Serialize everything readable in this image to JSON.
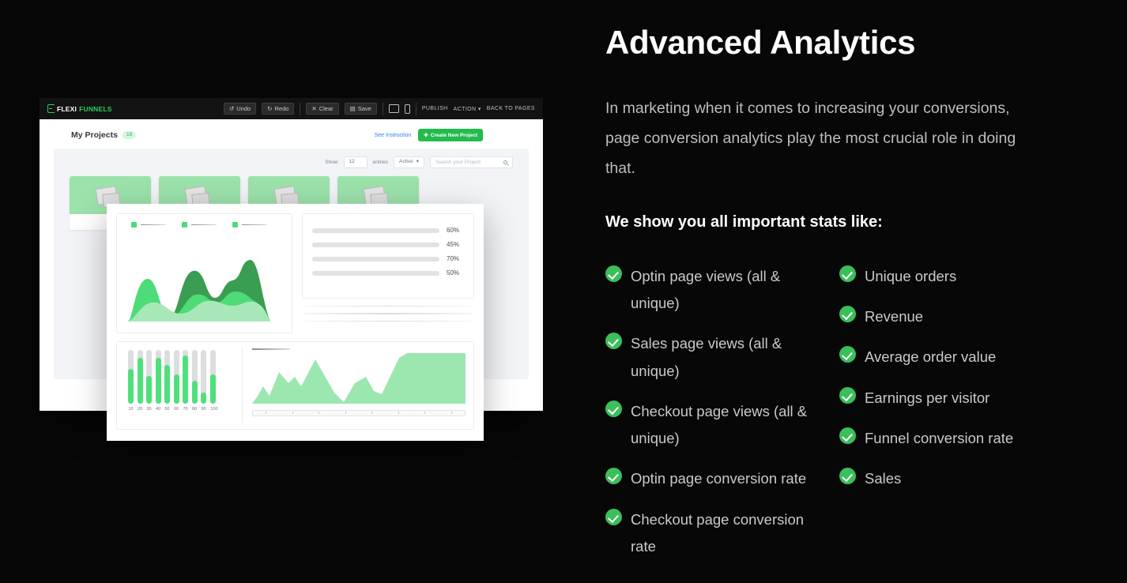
{
  "app": {
    "logo": {
      "first": "FLEXI",
      "second": "FUNNELS",
      "icon": "flexifunnels-logo-icon"
    },
    "toolbar": {
      "undo": "Undo",
      "redo": "Redo",
      "clear": "Clear",
      "save": "Save",
      "desktop_icon": "desktop-view-icon",
      "mobile_icon": "mobile-view-icon",
      "publish": "PUBLISH",
      "action": "ACTION",
      "back_to_pages": "BACK TO PAGES"
    },
    "projects": {
      "title": "My Projects",
      "count": "19",
      "see_instruction": "See Instruction",
      "create_button": "Create New Project",
      "create_button_icon": "plus-icon",
      "controls": {
        "show_label": "Show",
        "entries_value": "12",
        "entries_label": "entries",
        "status_value": "Active",
        "search_placeholder": "Search your Project",
        "search_icon": "search-icon"
      },
      "cards": [
        "project-card-1",
        "project-card-2",
        "project-card-3",
        "project-card-4"
      ]
    }
  },
  "analytics_card": {
    "legend": [
      {
        "color": "#4ddc77"
      },
      {
        "color": "#4ddc77"
      },
      {
        "color": "#4ddc77"
      }
    ],
    "progress_bars": [
      {
        "label": "60%",
        "value": 60,
        "color": "#4fe07c"
      },
      {
        "label": "45%",
        "value": 45,
        "color": "#5a3338"
      },
      {
        "label": "70%",
        "value": 70,
        "color": "#5a3338"
      },
      {
        "label": "50%",
        "value": 50,
        "color": "#5a3338"
      }
    ]
  },
  "chart_data": [
    {
      "type": "area",
      "title": "",
      "xlabel": "",
      "ylabel": "",
      "grid": false,
      "legend": "top-left",
      "series": [
        {
          "name": "series-dark",
          "color": "#3a9e52",
          "values": [
            8,
            14,
            30,
            22,
            58,
            48,
            40,
            52,
            46,
            66,
            60,
            20
          ]
        },
        {
          "name": "series-medium",
          "color": "#4ddc77",
          "values": [
            6,
            42,
            34,
            14,
            26,
            22,
            18,
            32,
            26,
            30,
            36,
            12
          ]
        },
        {
          "name": "series-light",
          "color": "#a8e8b8",
          "values": [
            4,
            20,
            22,
            18,
            24,
            20,
            22,
            26,
            22,
            24,
            26,
            8
          ]
        }
      ]
    },
    {
      "type": "bar",
      "title": "",
      "xlabel": "",
      "ylabel": "",
      "ylim": [
        0,
        100
      ],
      "categories": [
        "10",
        "20",
        "30",
        "40",
        "50",
        "60",
        "70",
        "80",
        "90",
        "100"
      ],
      "values": [
        65,
        85,
        52,
        85,
        72,
        55,
        90,
        42,
        20,
        55
      ],
      "color": "#4fe07c",
      "track_color": "#dddddd"
    },
    {
      "type": "area",
      "title": "",
      "xlabel": "",
      "ylabel": "",
      "grid": false,
      "color": "#9ce7b0",
      "x": [
        0,
        1,
        2,
        3,
        4,
        5,
        6,
        7,
        8,
        9,
        10,
        11,
        12,
        13,
        14,
        15
      ],
      "values": [
        8,
        26,
        14,
        52,
        34,
        50,
        30,
        78,
        44,
        10,
        40,
        48,
        22,
        16,
        70,
        92
      ]
    }
  ],
  "marketing": {
    "headline": "Advanced Analytics",
    "paragraph": "In marketing when it comes to increasing your conversions, page conversion analytics play the most crucial role in doing that.",
    "subhead": "We show you all important stats like:",
    "columns": [
      {
        "items": [
          "Optin page views (all & unique)",
          "Sales page views (all & unique)",
          "Checkout page views (all & unique)",
          "Optin page conversion rate",
          "Checkout page conversion rate"
        ]
      },
      {
        "items": [
          "Unique orders",
          "Revenue",
          "Average order value",
          "Earnings per visitor",
          "Funnel conversion rate",
          "Sales"
        ]
      }
    ],
    "colors": {
      "accent_green": "#3abf5b",
      "text_gray": "#c9c9c9",
      "background": "#070707"
    }
  }
}
